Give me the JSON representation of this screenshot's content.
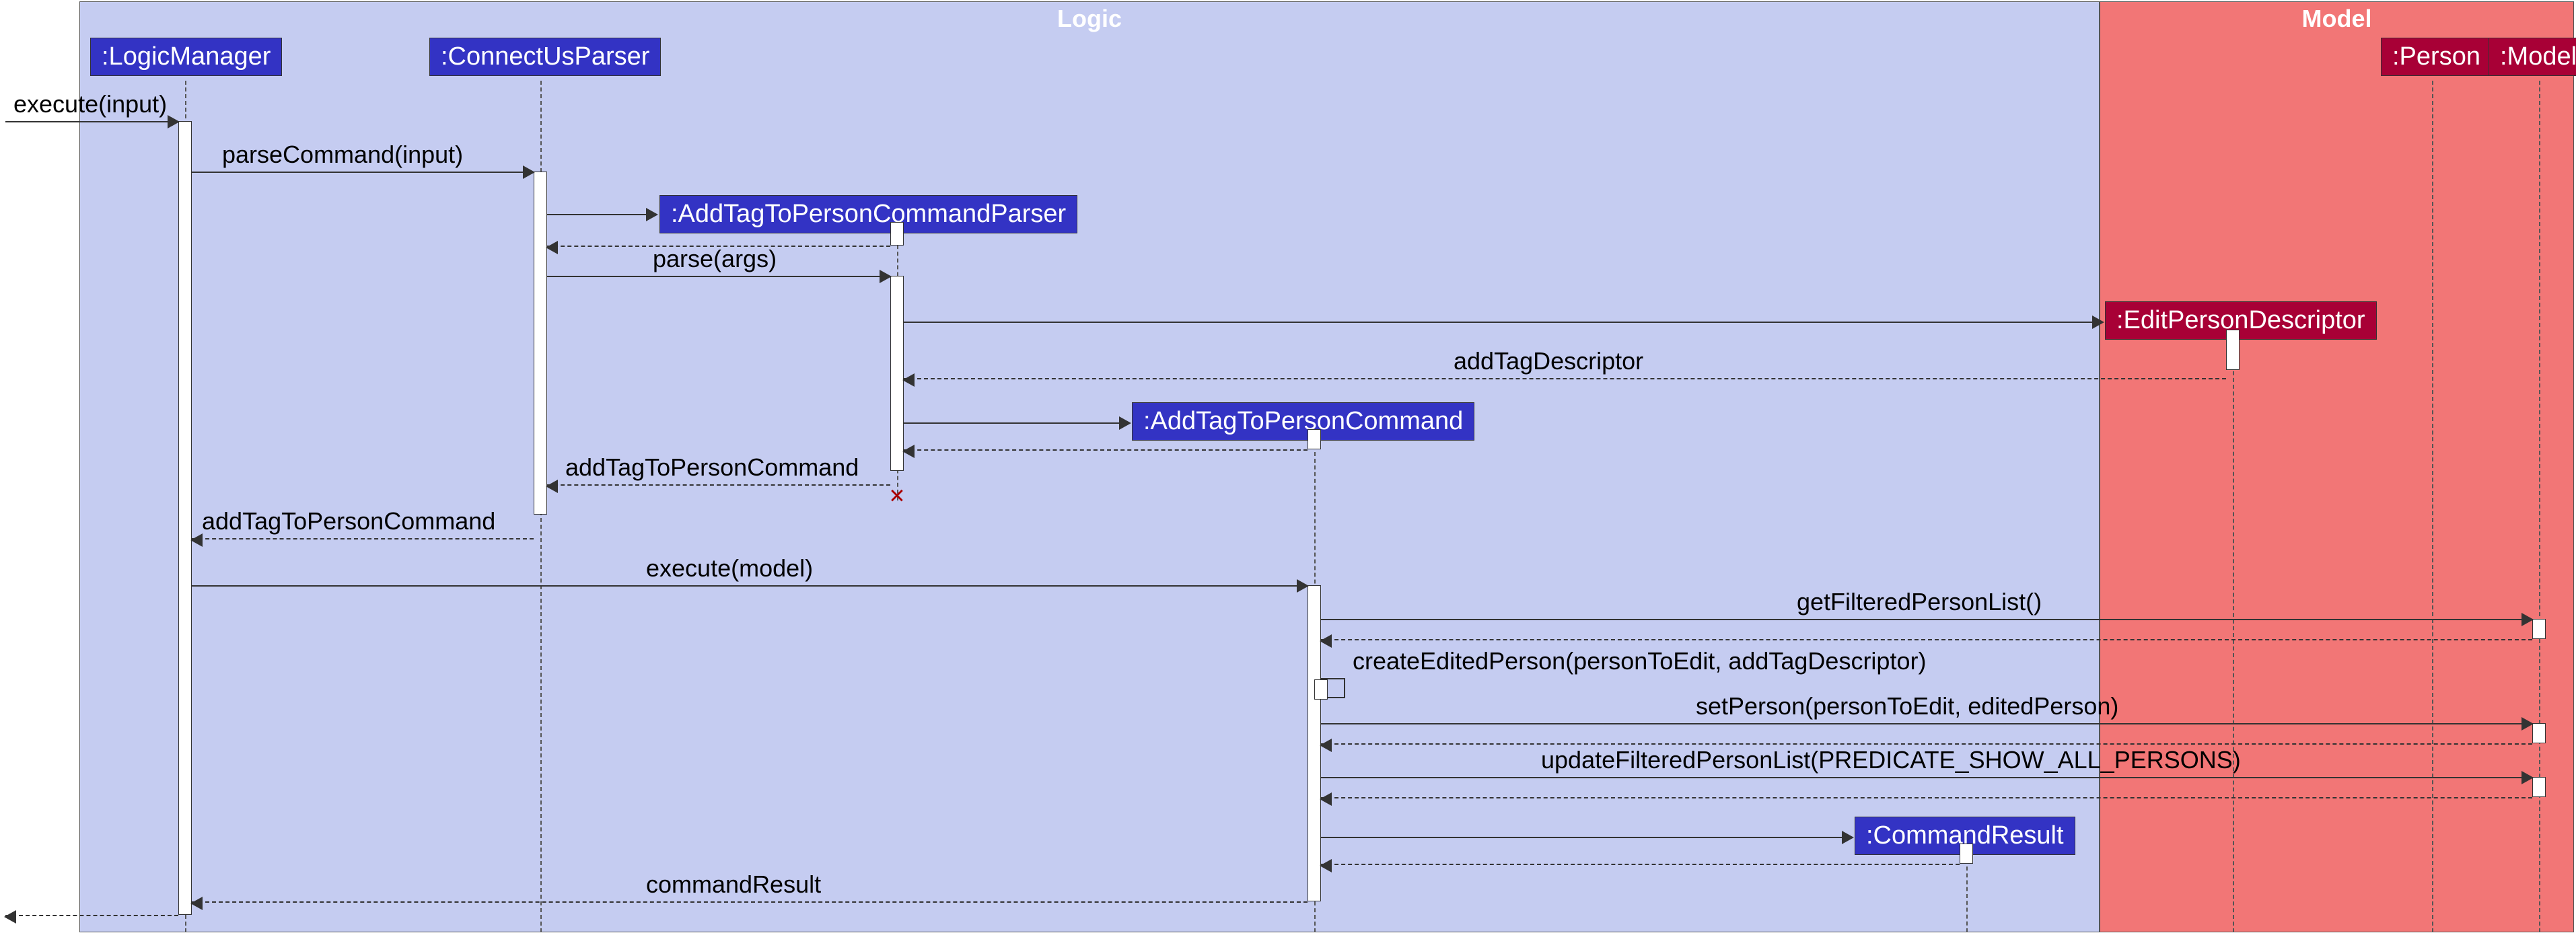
{
  "partitions": {
    "logic": "Logic",
    "model": "Model"
  },
  "participants": {
    "logicManager": ":LogicManager",
    "connectUsParser": ":ConnectUsParser",
    "addTagParser": ":AddTagToPersonCommandParser",
    "addTagCommand": ":AddTagToPersonCommand",
    "commandResult": ":CommandResult",
    "editPersonDescriptor": ":EditPersonDescriptor",
    "person": ":Person",
    "model": ":Model"
  },
  "messages": {
    "execute_input": "execute(input)",
    "parseCommand": "parseCommand(input)",
    "parse": "parse(args)",
    "addTagDescriptor": "addTagDescriptor",
    "addTagToPersonCommand_return1": "addTagToPersonCommand",
    "addTagToPersonCommand_return2": "addTagToPersonCommand",
    "execute_model": "execute(model)",
    "getFilteredPersonList": "getFilteredPersonList()",
    "createEditedPerson": "createEditedPerson(personToEdit, addTagDescriptor)",
    "setPerson": "setPerson(personToEdit, editedPerson)",
    "updateFilteredPersonList": "updateFilteredPersonList(PREDICATE_SHOW_ALL_PERSONS)",
    "commandResult": "commandResult"
  }
}
